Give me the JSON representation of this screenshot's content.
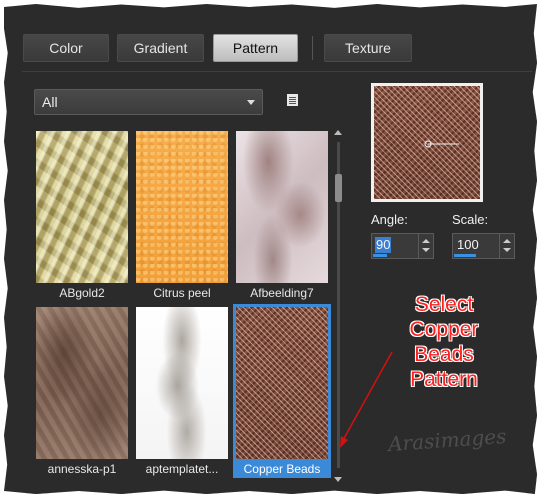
{
  "tabs": [
    {
      "label": "Color",
      "active": false
    },
    {
      "label": "Gradient",
      "active": false
    },
    {
      "label": "Pattern",
      "active": true
    },
    {
      "label": "Texture",
      "active": false
    }
  ],
  "filter": {
    "selected": "All"
  },
  "patterns": [
    {
      "name": "ABgold2",
      "selected": false
    },
    {
      "name": "Citrus peel",
      "selected": false
    },
    {
      "name": "Afbeelding7",
      "selected": false
    },
    {
      "name": "annesska-p1",
      "selected": false
    },
    {
      "name": "aptemplatet...",
      "selected": false
    },
    {
      "name": "Copper Beads",
      "selected": true
    }
  ],
  "angle": {
    "label": "Angle:",
    "value": "90"
  },
  "scale": {
    "label": "Scale:",
    "value": "100"
  },
  "annotation": {
    "lines": [
      "Select",
      "Copper",
      "Beads",
      "Pattern"
    ]
  },
  "watermark": "Arasimages",
  "colors": {
    "annotation": "#ff2020",
    "selection": "#3b8ad8",
    "accent_bar": "#3a90e4"
  }
}
